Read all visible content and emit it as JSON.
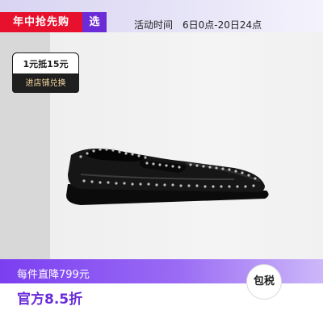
{
  "top_bar": {
    "promo_tag": "年中抢先购",
    "select_tag": "选",
    "event_label": "活动时间",
    "event_time": "6日0点-20日24点"
  },
  "coupon": {
    "value": "1元抵15元",
    "action": "进店铺兑换"
  },
  "product": {
    "image": "black-studded-penny-loafer"
  },
  "bottom_banner": {
    "offer": "每件直降799元",
    "discount": "官方8.5折",
    "badge": "包税"
  },
  "colors": {
    "promo_red": "#e8112d",
    "brand_purple": "#6b2bd6",
    "banner_purple": "#7b3ff0",
    "coupon_dark": "#1a1a1a"
  }
}
